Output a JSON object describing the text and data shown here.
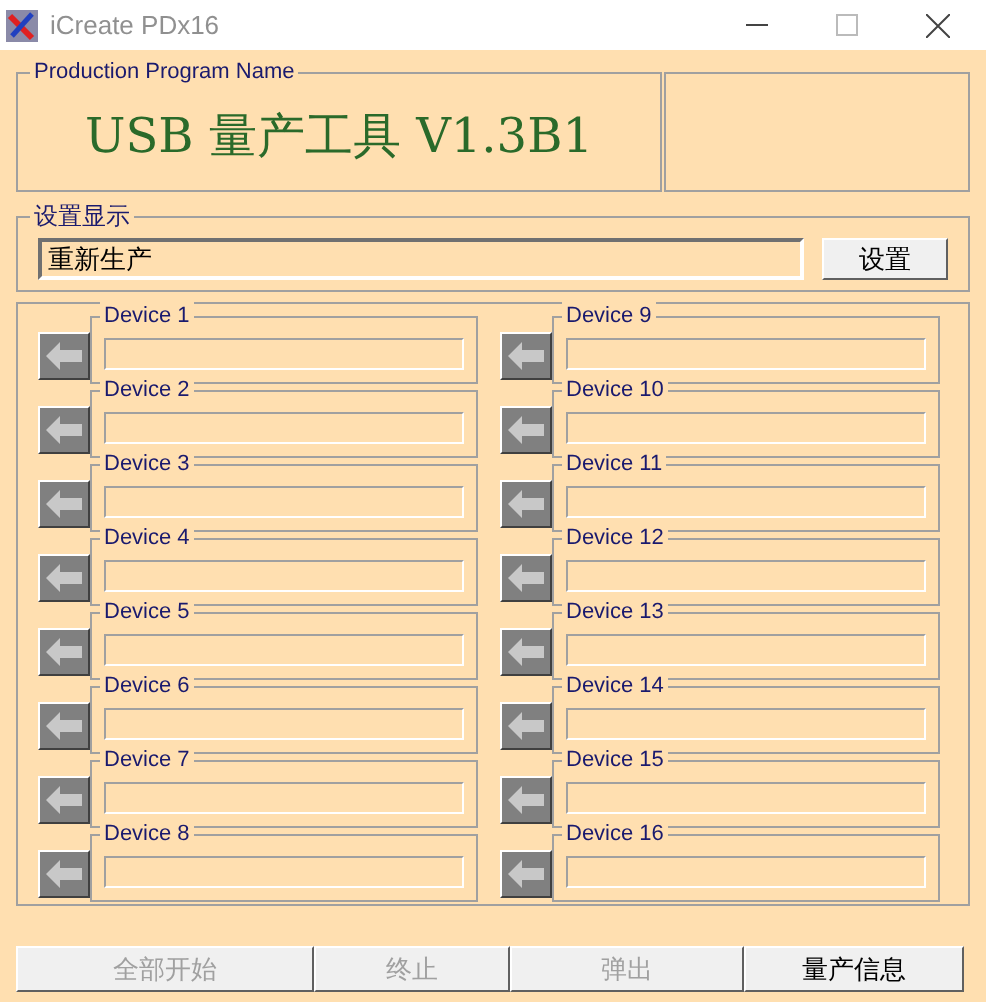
{
  "window": {
    "title": "iCreate PDx16"
  },
  "program": {
    "legend": "Production Program Name",
    "name": "USB 量产工具 V1.3B1"
  },
  "settings": {
    "legend": "设置显示",
    "value": "重新生产",
    "button": "设置"
  },
  "devices": [
    {
      "label": "Device 1"
    },
    {
      "label": "Device 2"
    },
    {
      "label": "Device 3"
    },
    {
      "label": "Device 4"
    },
    {
      "label": "Device 5"
    },
    {
      "label": "Device 6"
    },
    {
      "label": "Device 7"
    },
    {
      "label": "Device 8"
    },
    {
      "label": "Device 9"
    },
    {
      "label": "Device 10"
    },
    {
      "label": "Device 11"
    },
    {
      "label": "Device 12"
    },
    {
      "label": "Device 13"
    },
    {
      "label": "Device 14"
    },
    {
      "label": "Device 15"
    },
    {
      "label": "Device 16"
    }
  ],
  "buttons": [
    {
      "label": "全部开始",
      "disabled": true
    },
    {
      "label": "终止",
      "disabled": true
    },
    {
      "label": "弹出",
      "disabled": true
    },
    {
      "label": "量产信息",
      "disabled": false
    }
  ]
}
